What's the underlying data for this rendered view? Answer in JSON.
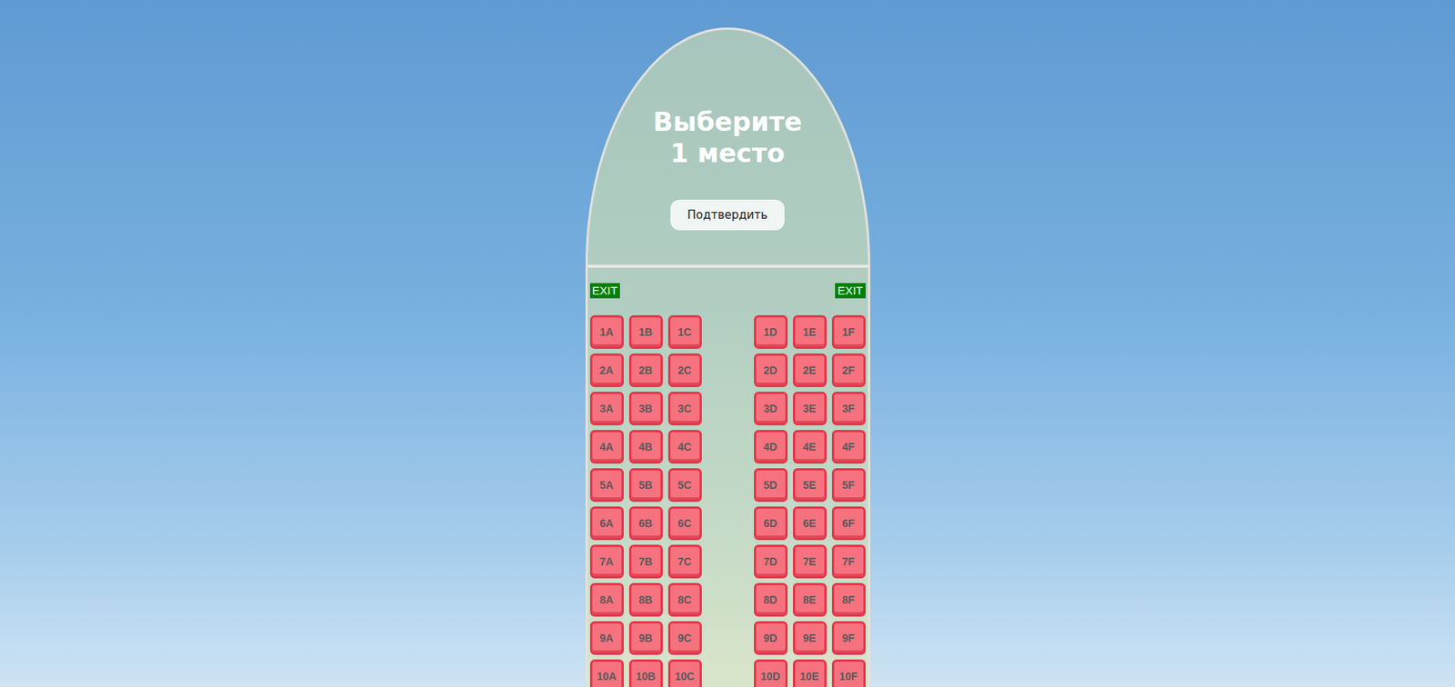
{
  "title": "Выберите 1 место",
  "confirm_button": "Подтвердить",
  "exits": [
    "EXIT",
    "EXIT"
  ],
  "seat_rows": [
    [
      "1A",
      "1B",
      "1C",
      "1D",
      "1E",
      "1F"
    ],
    [
      "2A",
      "2B",
      "2C",
      "2D",
      "2E",
      "2F"
    ],
    [
      "3A",
      "3B",
      "3C",
      "3D",
      "3E",
      "3F"
    ],
    [
      "4A",
      "4B",
      "4C",
      "4D",
      "4E",
      "4F"
    ],
    [
      "5A",
      "5B",
      "5C",
      "5D",
      "5E",
      "5F"
    ],
    [
      "6A",
      "6B",
      "6C",
      "6D",
      "6E",
      "6F"
    ],
    [
      "7A",
      "7B",
      "7C",
      "7D",
      "7E",
      "7F"
    ],
    [
      "8A",
      "8B",
      "8C",
      "8D",
      "8E",
      "8F"
    ],
    [
      "9A",
      "9B",
      "9C",
      "9D",
      "9E",
      "9F"
    ],
    [
      "10A",
      "10B",
      "10C",
      "10D",
      "10E",
      "10F"
    ]
  ]
}
